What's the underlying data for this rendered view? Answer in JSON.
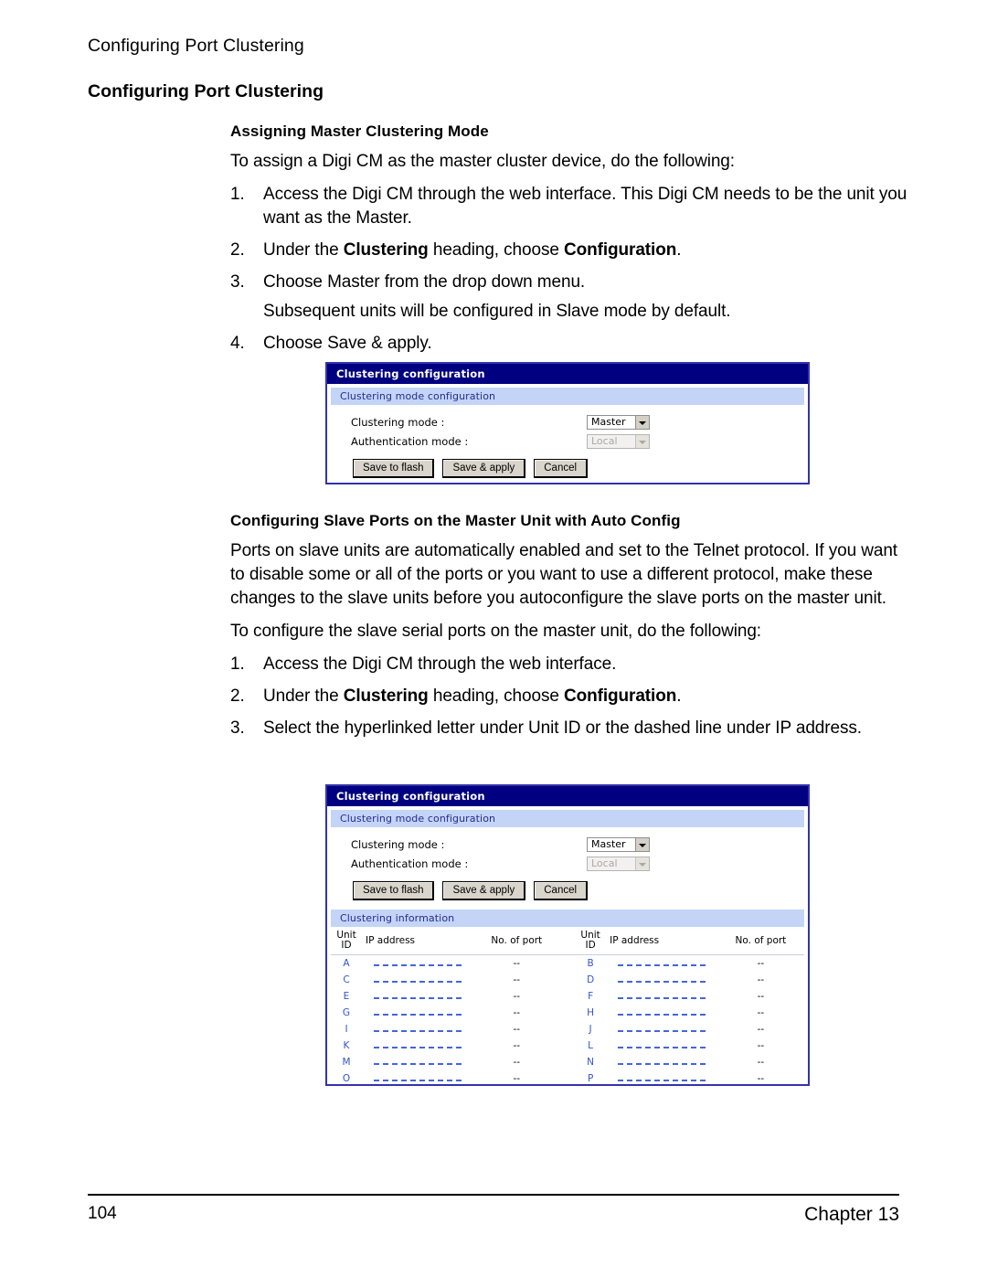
{
  "page": {
    "running_head": "Configuring Port Clustering",
    "heading": "Configuring Port Clustering",
    "footer_page_number": "104",
    "footer_chapter": "Chapter 13"
  },
  "section1": {
    "subheading": "Assigning Master Clustering Mode",
    "intro": "To assign a Digi CM as the master cluster device, do the following:",
    "steps": [
      {
        "num": "1.",
        "text_before": "Access the Digi CM through the web interface. This Digi CM needs to be the unit you want as the Master.",
        "bold1": "",
        "text_mid": "",
        "bold2": "",
        "text_after": ""
      },
      {
        "num": "2.",
        "text_before": "Under the ",
        "bold1": "Clustering",
        "text_mid": " heading, choose ",
        "bold2": "Configuration",
        "text_after": "."
      },
      {
        "num": "3.",
        "text_before": "Choose Master from the drop down menu.",
        "bold1": "",
        "text_mid": "",
        "bold2": "",
        "text_after": ""
      }
    ],
    "step3_note": "Subsequent units will be configured in Slave mode by default.",
    "step4": {
      "num": "4.",
      "text": "Choose Save & apply."
    }
  },
  "section2": {
    "subheading": "Configuring Slave Ports on the Master Unit with Auto Config",
    "para1": "Ports on slave units are automatically enabled and set to the Telnet protocol. If you want to disable some or all of the ports or you want to use a different protocol, make these changes to the slave units before you autoconfigure the slave ports on the master unit.",
    "para2": "To configure the slave serial ports on the master unit, do the following:",
    "steps": [
      {
        "num": "1.",
        "text_before": "Access the Digi CM through the web interface.",
        "bold1": "",
        "text_mid": "",
        "bold2": "",
        "text_after": ""
      },
      {
        "num": "2.",
        "text_before": "Under the ",
        "bold1": "Clustering",
        "text_mid": " heading, choose ",
        "bold2": "Configuration",
        "text_after": "."
      },
      {
        "num": "3.",
        "text_before": "Select the hyperlinked letter under Unit ID or the dashed line under IP address.",
        "bold1": "",
        "text_mid": "",
        "bold2": "",
        "text_after": ""
      }
    ]
  },
  "ui": {
    "title": "Clustering configuration",
    "mode_section_title": "Clustering mode configuration",
    "info_section_title": "Clustering information",
    "fields": {
      "clustering_mode_label": "Clustering mode :",
      "clustering_mode_value": "Master",
      "auth_mode_label": "Authentication mode :",
      "auth_mode_value": "Local"
    },
    "buttons": {
      "save_to_flash": "Save to flash",
      "save_and_apply": "Save & apply",
      "cancel": "Cancel"
    },
    "table": {
      "headers": {
        "unit_id": "Unit ID",
        "unit_id_line1": "Unit",
        "unit_id_line2": "ID",
        "ip_address": "IP address",
        "no_of_port": "No. of port"
      },
      "dash_placeholder": "--",
      "rows": [
        {
          "left_id": "A",
          "left_ip": "--------------",
          "left_ports": "--",
          "right_id": "B",
          "right_ip": "--------------",
          "right_ports": "--"
        },
        {
          "left_id": "C",
          "left_ip": "--------------",
          "left_ports": "--",
          "right_id": "D",
          "right_ip": "--------------",
          "right_ports": "--"
        },
        {
          "left_id": "E",
          "left_ip": "--------------",
          "left_ports": "--",
          "right_id": "F",
          "right_ip": "--------------",
          "right_ports": "--"
        },
        {
          "left_id": "G",
          "left_ip": "--------------",
          "left_ports": "--",
          "right_id": "H",
          "right_ip": "--------------",
          "right_ports": "--"
        },
        {
          "left_id": "I",
          "left_ip": "--------------",
          "left_ports": "--",
          "right_id": "J",
          "right_ip": "--------------",
          "right_ports": "--"
        },
        {
          "left_id": "K",
          "left_ip": "--------------",
          "left_ports": "--",
          "right_id": "L",
          "right_ip": "--------------",
          "right_ports": "--"
        },
        {
          "left_id": "M",
          "left_ip": "--------------",
          "left_ports": "--",
          "right_id": "N",
          "right_ip": "--------------",
          "right_ports": "--"
        },
        {
          "left_id": "O",
          "left_ip": "--------------",
          "left_ports": "--",
          "right_id": "P",
          "right_ip": "--------------",
          "right_ports": "--"
        }
      ]
    },
    "colors": {
      "titlebar_bg": "#000080",
      "section_header_bg": "#c3d4f7",
      "section_header_text": "#2a2a8c",
      "border": "#3333aa",
      "link": "#3355cc",
      "button_bg": "#d9d5cc"
    }
  }
}
